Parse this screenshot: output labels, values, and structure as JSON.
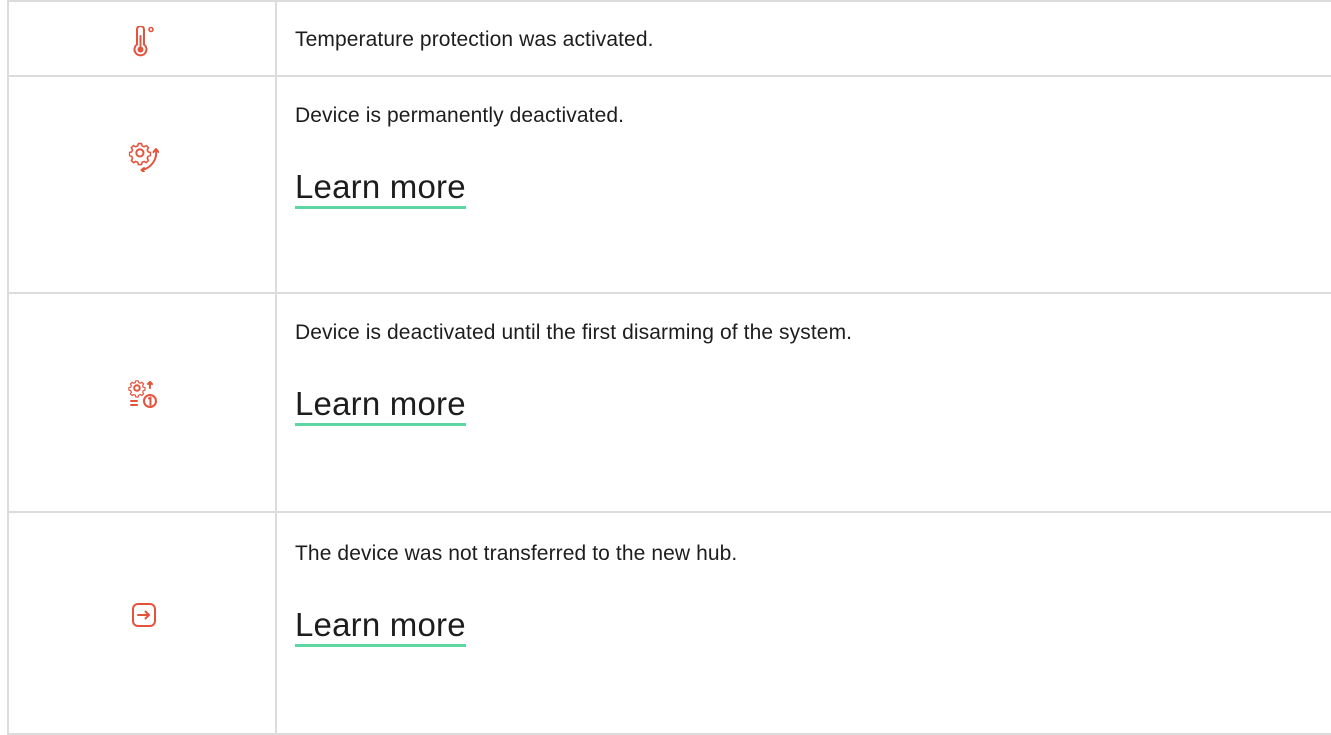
{
  "icon_color": "#e5533d",
  "link_underline_color": "#5ed6a1",
  "rows": [
    {
      "icon": "thermometer-icon",
      "description": "Temperature protection was activated."
    },
    {
      "icon": "gear-deactivated-icon",
      "description": "Device is permanently deactivated.",
      "link_label": "Learn more"
    },
    {
      "icon": "gear-deactivated-once-icon",
      "description": "Device is deactivated until the first disarming of the system.",
      "link_label": "Learn more"
    },
    {
      "icon": "transfer-arrow-icon",
      "description": "The device was not transferred to the new hub.",
      "link_label": "Learn more"
    }
  ]
}
